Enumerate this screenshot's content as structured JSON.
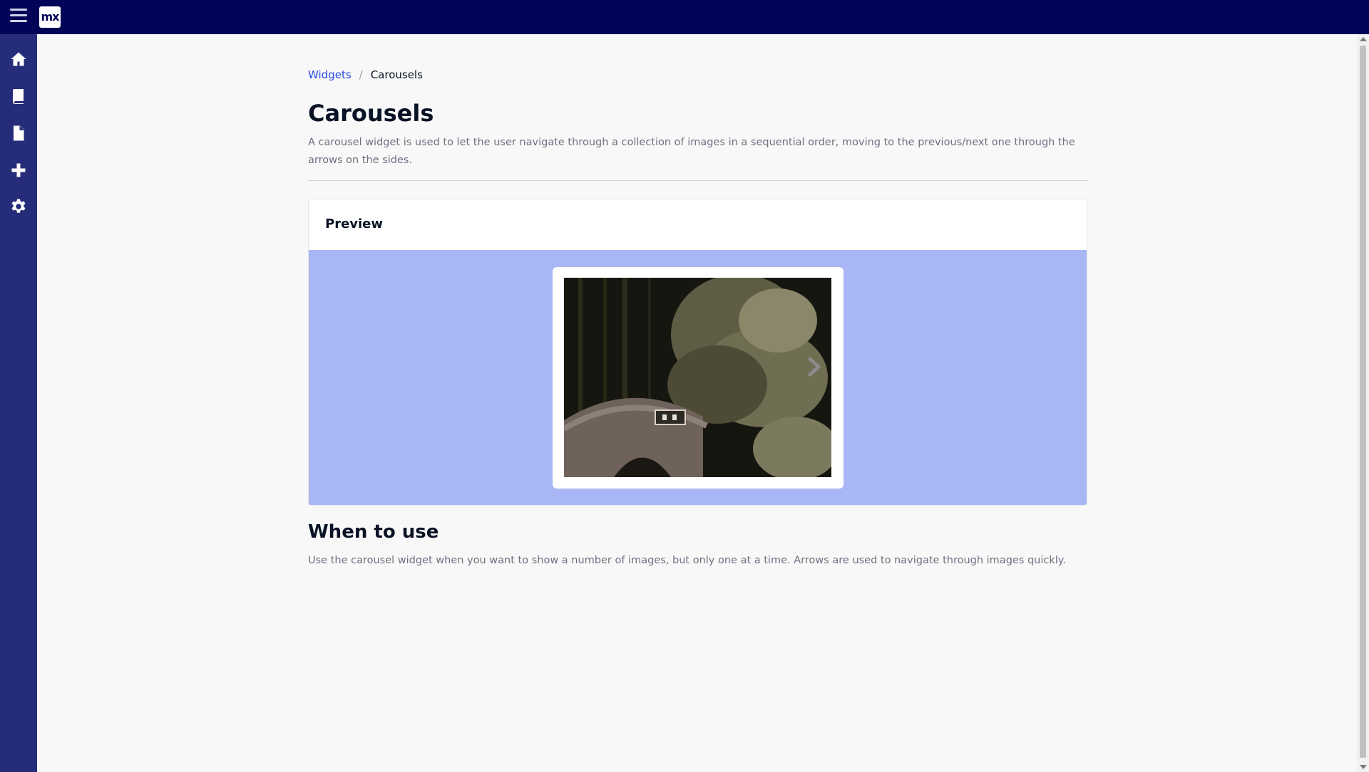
{
  "header": {
    "logo_text": "mx",
    "colors": {
      "topbar": "#020557",
      "sidenav": "#252c79"
    }
  },
  "sidenav": {
    "items": [
      {
        "icon": "home-icon"
      },
      {
        "icon": "book-icon"
      },
      {
        "icon": "file-icon"
      },
      {
        "icon": "plus-icon"
      },
      {
        "icon": "gear-icon"
      }
    ]
  },
  "breadcrumb": {
    "parent": "Widgets",
    "separator": "/",
    "current": "Carousels"
  },
  "page": {
    "title": "Carousels",
    "description": "A carousel widget is used to let the user navigate through a collection of images in a sequential order, moving to the previous/next one through the arrows on the sides."
  },
  "preview": {
    "title": "Preview",
    "stage_color": "#a8b6f5",
    "next_icon": "chevron-right-icon"
  },
  "usage": {
    "title": "When to use",
    "text": "Use the carousel widget when you want to show a number of images, but only one at a time. Arrows are used to navigate through images quickly."
  }
}
